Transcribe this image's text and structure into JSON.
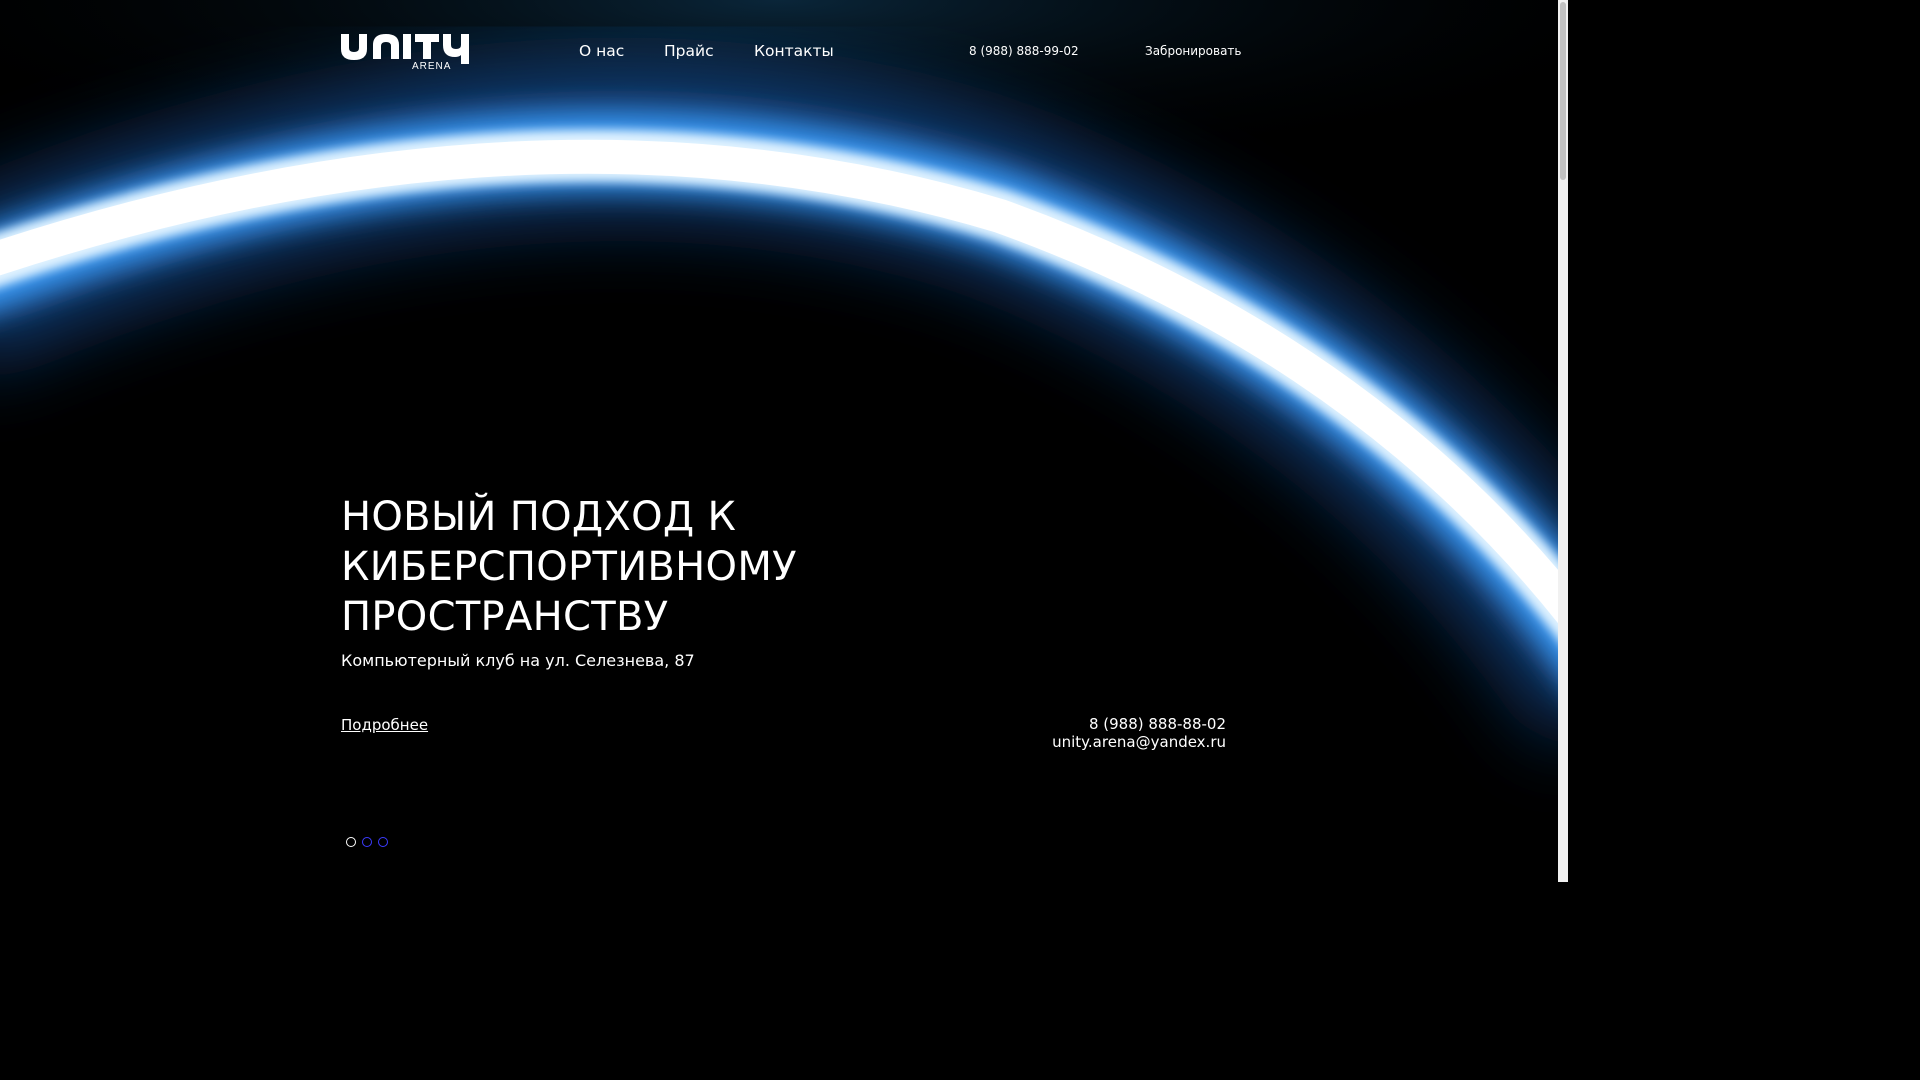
{
  "header": {
    "logo_word": "UNITY",
    "logo_sub": "ARENA",
    "nav": [
      {
        "label": "О нас"
      },
      {
        "label": "Прайс"
      },
      {
        "label": "Контакты"
      }
    ],
    "phone": "8 (988) 888-99-02",
    "book_label": "Забронировать"
  },
  "hero": {
    "title_lines": [
      "НОВЫЙ ПОДХОД К",
      "КИБЕРСПОРТИВНОМУ",
      "ПРОСТРАНСТВУ"
    ],
    "subtitle": "Компьютерный клуб на ул. Селезнева, 87",
    "more_label": "Подробнее",
    "contact_phone": "8 (988) 888-88-02",
    "contact_email": "unity.arena@yandex.ru"
  },
  "slider": {
    "slide_count": 3,
    "active_index": 0
  },
  "colors": {
    "background": "#000000",
    "glow": "#1e90ff",
    "dot_inactive": "#3b3bff",
    "dot_active": "#ffffff"
  }
}
